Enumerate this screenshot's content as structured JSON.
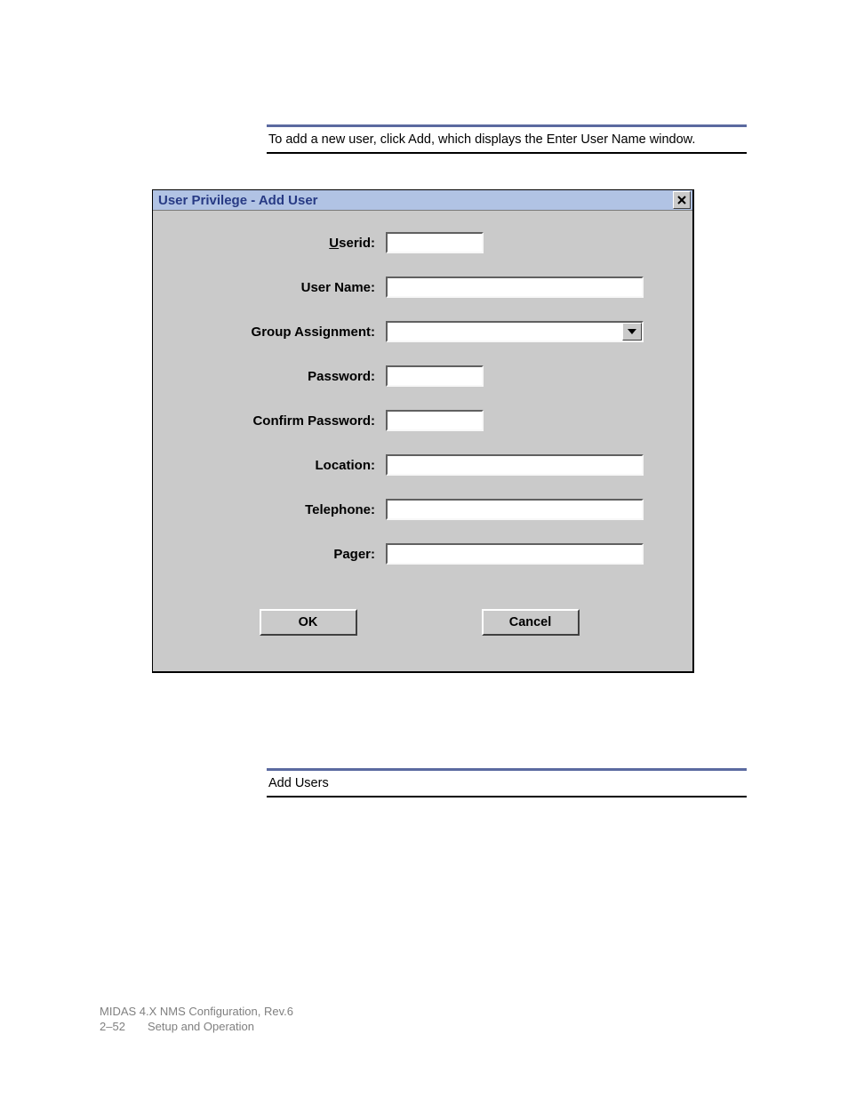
{
  "caption_top": "To add a new user, click Add, which displays the Enter User Name window.",
  "dialog": {
    "title": "User Privilege - Add User",
    "fields": {
      "userid_label_prefix": "U",
      "userid_label_rest": "serid:",
      "username_label": "User Name:",
      "group_label": "Group Assignment:",
      "password_label": "Password:",
      "confirm_label": "Confirm Password:",
      "location_label": "Location:",
      "telephone_label": "Telephone:",
      "pager_label": "Pager:",
      "userid_value": "",
      "username_value": "",
      "group_value": "",
      "password_value": "",
      "confirm_value": "",
      "location_value": "",
      "telephone_value": "",
      "pager_value": ""
    },
    "buttons": {
      "ok": "OK",
      "cancel": "Cancel"
    }
  },
  "caption_bottom": "Add Users",
  "footer": {
    "line1": "MIDAS 4.X NMS Configuration, Rev.6",
    "page": "2–52",
    "section": "Setup and Operation"
  }
}
